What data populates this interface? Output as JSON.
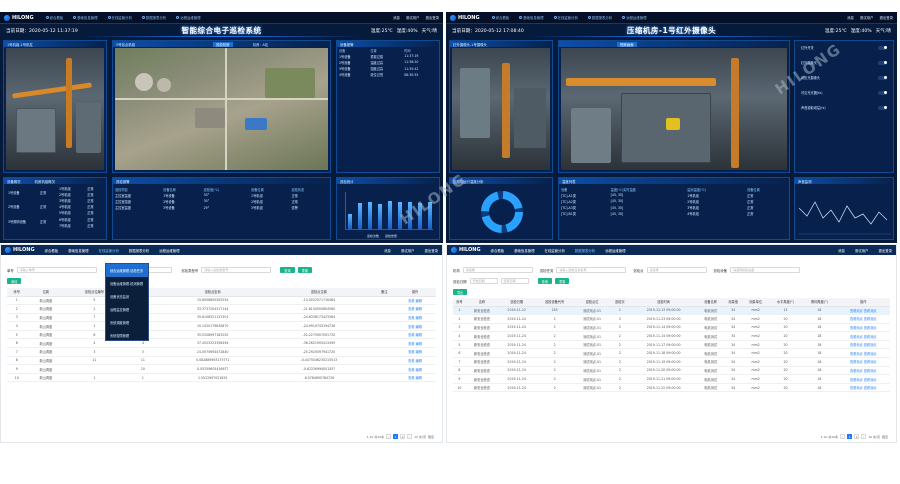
{
  "brand": "HILONG",
  "nav": [
    "综合看板",
    "基础信息管理",
    "在线监管分析",
    "数据报表分析",
    "远程运维管理"
  ],
  "topright": {
    "msg": "消息",
    "user": "测试用户",
    "exit": "退出登录"
  },
  "dash1": {
    "date_label": "当前日期：",
    "date": "2020-05-12 11:37:19",
    "title": "智能综合电子巡检系统",
    "temp_label": "温度:",
    "temp": "25℃",
    "hum_label": "湿度:",
    "hum": "40%",
    "weather_label": "天气:",
    "weather": "晴",
    "cam_left_title": "1号机组-1号机柱",
    "aerial_title": "Y号站点机组",
    "aerial_tag": "巡检机房",
    "aerial_tag2": "机房：A站",
    "right_title": "设备报警",
    "right_headers": [
      "设备",
      "位置",
      "时间"
    ],
    "right_rows": [
      [
        "1号设备",
        "重载过载",
        "11:37:19"
      ],
      [
        "2号设备",
        "温度过高",
        "11:36:20"
      ],
      [
        "3号设备",
        "湿度过高",
        "11:35:42"
      ],
      [
        "4号设备",
        "液位过低",
        "08:30:55"
      ]
    ],
    "stat_title": "设备概况",
    "stat_title2": "机房机组概况",
    "stat_left": [
      [
        "1号设备",
        "正常"
      ],
      [
        "2号设备",
        "正常"
      ],
      [
        "3号照明设备",
        "正常"
      ]
    ],
    "stat_mid": [
      [
        "1号机组",
        "正常"
      ],
      [
        "2号机组",
        "正常"
      ],
      [
        "3号机组",
        "正常"
      ],
      [
        "4号机组",
        "正常"
      ],
      [
        "5号机组",
        "正常"
      ],
      [
        "6号机组",
        "正常"
      ],
      [
        "7号机组",
        "正常"
      ]
    ],
    "alarm_title": "巡检报警",
    "alarm_headers": [
      "巡检项目",
      "设备名称",
      "巡检值(℃)",
      "设备位置",
      "巡检状态"
    ],
    "alarm_rows": [
      [
        "主控室温度",
        "1号设备",
        "30°",
        "1号机组",
        "正常"
      ],
      [
        "主控室湿度",
        "2号设备",
        "30°",
        "2号机组",
        "正常"
      ],
      [
        "主控室温度",
        "3号设备",
        "29°",
        "3号机组",
        "告警"
      ]
    ],
    "chart_title": "巡检统计",
    "chart_legend": [
      "巡检次数",
      "巡检告警"
    ]
  },
  "chart_data": {
    "type": "bar",
    "title": "巡检统计",
    "series": [
      {
        "name": "巡检次数",
        "values": [
          40,
          70,
          72,
          68,
          75,
          74,
          73,
          71,
          72
        ]
      }
    ],
    "ylim": [
      0,
      100
    ]
  },
  "dash2": {
    "date_label": "当前日期：",
    "date": "2020-05-12 17:08:40",
    "title": "压缩机房-1号红外摄像头",
    "temp_label": "温度:",
    "temp": "25℃",
    "hum_label": "湿度:",
    "hum": "40%",
    "weather_label": "天气:",
    "weather": "晴",
    "cam_small_title": "红外摄像头-1号摄像头",
    "cam_big_tag": "视频画面",
    "ctrl_items": [
      "红外开关",
      "红外摄像头",
      "可见光摄像头",
      "可见光光圈(fx)",
      "声音拾取增益(fx)"
    ],
    "donut_title": "压缩机运行温度分析",
    "temp_table_title": "温度列表",
    "temp_headers": [
      "设备",
      "温度(℃)实时温度",
      "监测温度(℃)",
      "设备位置"
    ],
    "temp_rows": [
      [
        "[TC]-A1类",
        "[45, 30]",
        "1号机组",
        "正常"
      ],
      [
        "[TC]-A2类",
        "[45, 30]",
        "2号机组",
        "正常"
      ],
      [
        "[TC]-A3类",
        "[45, 30]",
        "3号机组",
        "正常"
      ],
      [
        "[TC]-B1类",
        "[45, 30]",
        "4号机组",
        "正常"
      ]
    ],
    "line_title": "声音监测"
  },
  "admin1": {
    "filter_label": "单号",
    "filter_ph": "请输入单号",
    "filter2_label": "设备地点",
    "filter2_ph": "请选择设备地点",
    "filter3_label": "巡检类型号",
    "filter3_ph": "请输入巡检类型号",
    "search": "查询",
    "reset": "重置",
    "add": "添加",
    "headers": [
      "序号",
      "位置",
      "巡检点位编号",
      "设备编号",
      "巡检点坐标",
      "巡检点位置",
      "备注",
      "操作"
    ],
    "rows": [
      [
        "1",
        "新山调度",
        "5",
        "",
        "15.6006800305254",
        "-13.0037071716484",
        "",
        "查看 编辑"
      ],
      [
        "2",
        "新山调度",
        "2",
        "",
        "33.3737204317144",
        "-21.6150505804560",
        "",
        "查看 编辑"
      ],
      [
        "3",
        "新山调度",
        "7",
        "",
        "35.6106521131301",
        "-24.6336173423384",
        "",
        "查看 编辑"
      ],
      [
        "4",
        "新山调度",
        "1",
        "5",
        "10.1420179630870",
        "-24.9919743194726",
        "",
        "查看 编辑"
      ],
      [
        "5",
        "新山调度",
        "6",
        "6",
        "35.5328997183250",
        "-52.2275907091720",
        "",
        "查看 编辑"
      ],
      [
        "6",
        "新山调度",
        "4",
        "4",
        "37.4523323356494",
        "-36.2621955413495",
        "",
        "查看 编辑"
      ],
      [
        "7",
        "新山调度",
        "3",
        "3",
        "24.0975694472840",
        "-25.2920597941720",
        "",
        "查看 编辑"
      ],
      [
        "8",
        "新山调度",
        "11",
        "11",
        "0.0828896931757?1",
        "-0.4475046235215513",
        "",
        "查看 编辑"
      ],
      [
        "9",
        "新山调度",
        "",
        "10",
        "0.0525960541667?",
        "-0.6222699400155?",
        "",
        "查看 编辑"
      ],
      [
        "10",
        "新山调度",
        "1",
        "1",
        "1.5522997021625",
        "-6.0784695784726",
        "",
        "查看 编辑"
      ]
    ],
    "pager_total": "1-10 共10条",
    "pager_size": "10 条/页",
    "pager_go": "跳至",
    "menu": [
      "综合运维管理-巡检任务",
      "设备运维管理-检测管理",
      "设备状态监测",
      "远程监控管理",
      "系统调度管理",
      "系统权限管理"
    ]
  },
  "admin2": {
    "filter_label": "机构",
    "filter_ph": "请选择",
    "filter2_label": "巡检任务",
    "filter2_ph": "请输入巡检任务名称",
    "filter3_label": "巡检点",
    "filter3_ph": "请选择",
    "filter4_label": "巡检设备",
    "filter4_ph": "请选择巡检设备",
    "date_label": "巡检日期",
    "date_from": "开始日期",
    "date_to": "结束日期",
    "search": "查询",
    "reset": "重置",
    "add": "导出",
    "headers": [
      "序号",
      "名称",
      "巡检日期",
      "巡检设备代号",
      "巡检点位",
      "巡检次",
      "巡检时间",
      "设备名称",
      "测量值",
      "测量单位",
      "水平角度(°)",
      "俯仰角度(°)",
      "操作"
    ],
    "rows": [
      [
        "1",
        "新安全检查",
        "2019-11-12",
        "255",
        "测试测点-01",
        "1",
        "2019-12-13 09:00:00",
        "电机测试",
        "34",
        "mm2",
        "15",
        "18",
        "查看测点 查看测点"
      ],
      [
        "2",
        "新安全检查",
        "2019-11-24",
        "2",
        "测试测点-01",
        "2",
        "2019-11-23 09:00:00",
        "电机测试",
        "34",
        "mm2",
        "20",
        "18",
        "查看测点 查看测点"
      ],
      [
        "3",
        "新安全检查",
        "2019-11-24",
        "2",
        "测试测点-01",
        "2",
        "2019-11-14 09:00:00",
        "电机测试",
        "34",
        "mm2",
        "20",
        "18",
        "查看测点 查看测点"
      ],
      [
        "4",
        "新安全检查",
        "2019-11-24",
        "2",
        "测试测点-01",
        "2",
        "2019-11-14 09:00:00",
        "电机测试",
        "34",
        "mm2",
        "20",
        "18",
        "查看测点 查看测点"
      ],
      [
        "5",
        "新安全检查",
        "2019-11-24",
        "2",
        "测试测点-01",
        "2",
        "2019-11-17 09:00:00",
        "电机测试",
        "34",
        "mm2",
        "20",
        "18",
        "查看测点 查看测点"
      ],
      [
        "6",
        "新安全检查",
        "2019-11-24",
        "2",
        "测试测点-01",
        "2",
        "2019-11-18 09:00:00",
        "电机测试",
        "34",
        "mm2",
        "20",
        "18",
        "查看测点 查看测点"
      ],
      [
        "7",
        "新安全检查",
        "2019-11-24",
        "2",
        "测试测点-01",
        "2",
        "2019-11-19 09:00:00",
        "电机测试",
        "34",
        "mm2",
        "20",
        "18",
        "查看测点 查看测点"
      ],
      [
        "8",
        "新安全检查",
        "2019-11-24",
        "2",
        "测试测点-01",
        "2",
        "2019-11-20 09:00:00",
        "电机测试",
        "34",
        "mm2",
        "20",
        "18",
        "查看测点 查看测点"
      ],
      [
        "9",
        "新安全检查",
        "2019-11-24",
        "2",
        "测试测点-01",
        "2",
        "2019-11-21 09:00:00",
        "电机测试",
        "34",
        "mm2",
        "20",
        "18",
        "查看测点 查看测点"
      ],
      [
        "10",
        "新安全检查",
        "2019-11-24",
        "2",
        "测试测点-01",
        "2",
        "2019-11-22 09:00:00",
        "电机测试",
        "34",
        "mm2",
        "20",
        "18",
        "查看测点 查看测点"
      ]
    ],
    "pager_total": "1-10 共10条",
    "pager_size": "10 条/页",
    "pager_go": "跳至"
  },
  "watermark": "HILONG"
}
